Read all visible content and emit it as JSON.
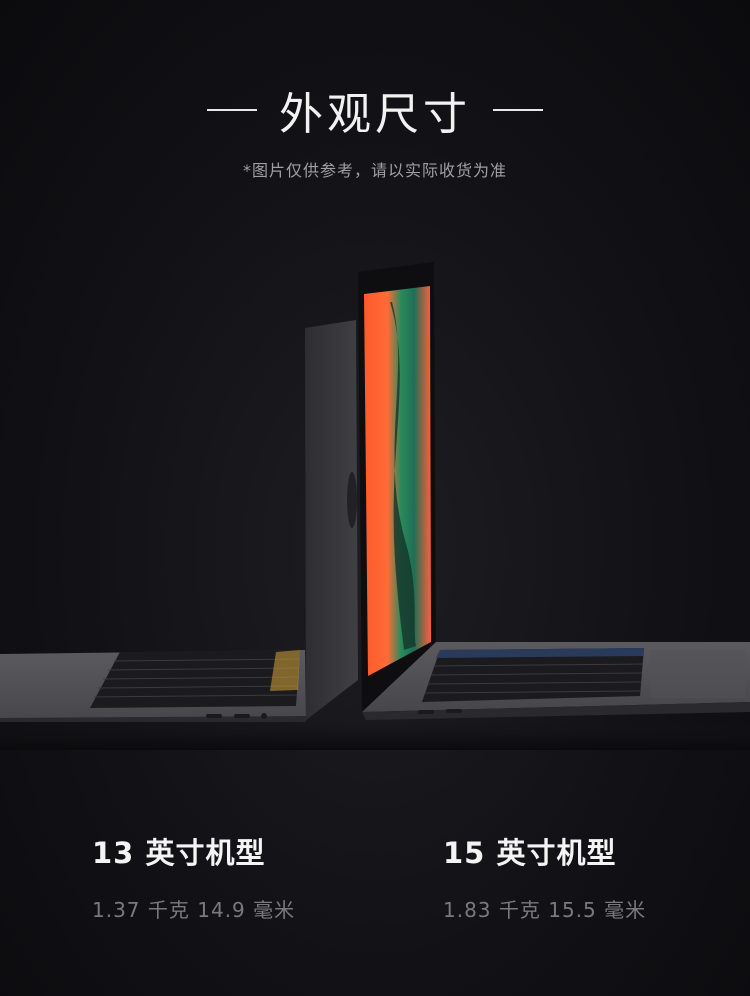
{
  "header": {
    "title": "外观尺寸",
    "subtitle": "*图片仅供参考，请以实际收货为准"
  },
  "models": [
    {
      "name": "13 英寸机型",
      "spec": "1.37 千克 14.9 毫米"
    },
    {
      "name": "15 英寸机型",
      "spec": "1.83 千克 15.5 毫米"
    }
  ]
}
